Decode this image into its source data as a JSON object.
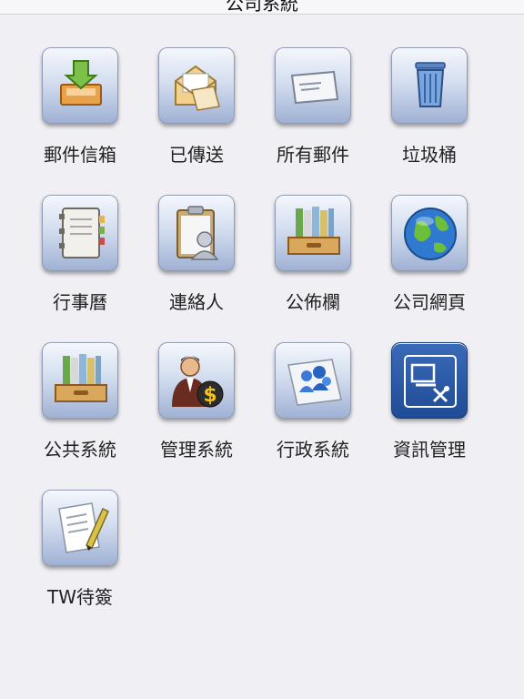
{
  "header": {
    "title": "公司系統"
  },
  "apps": [
    {
      "label": "郵件信箱",
      "icon": "inbox-tray-icon"
    },
    {
      "label": "已傳送",
      "icon": "open-envelope-icon"
    },
    {
      "label": "所有郵件",
      "icon": "envelope-icon"
    },
    {
      "label": "垃圾桶",
      "icon": "trash-can-icon"
    },
    {
      "label": "行事曆",
      "icon": "planner-notebook-icon"
    },
    {
      "label": "連絡人",
      "icon": "clipboard-contact-icon"
    },
    {
      "label": "公佈欄",
      "icon": "binders-drawer-icon"
    },
    {
      "label": "公司網頁",
      "icon": "globe-icon"
    },
    {
      "label": "公共系統",
      "icon": "binders-drawer-icon"
    },
    {
      "label": "管理系統",
      "icon": "manager-dollar-icon"
    },
    {
      "label": "行政系統",
      "icon": "people-group-icon"
    },
    {
      "label": "資訊管理",
      "icon": "computer-tools-icon"
    },
    {
      "label": "TW待簽",
      "icon": "document-pen-icon"
    }
  ]
}
